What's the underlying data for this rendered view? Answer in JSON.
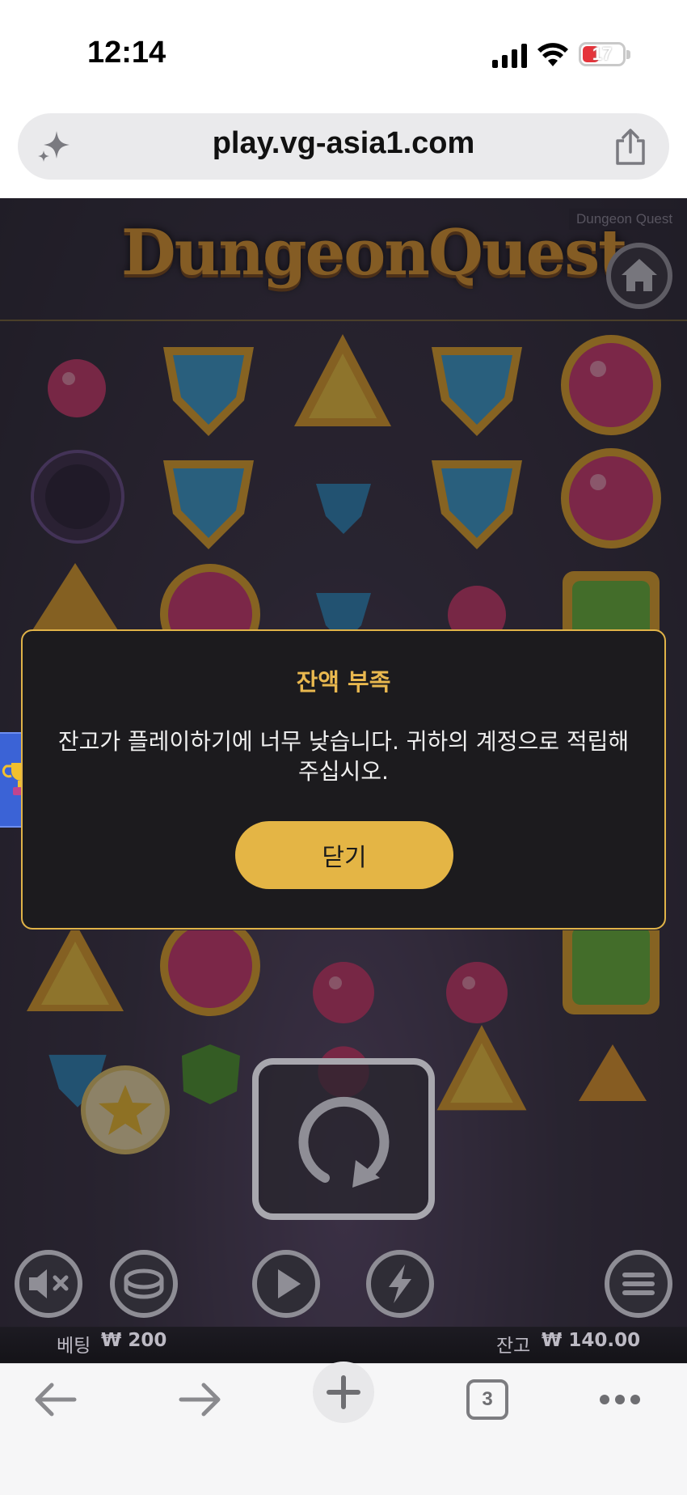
{
  "status_bar": {
    "time": "12:14",
    "battery_level": "17",
    "icons": [
      "signal-icon",
      "wifi-icon",
      "battery-icon"
    ]
  },
  "browser": {
    "url": "play.vg-asia1.com",
    "tab_count": "3",
    "icons": [
      "sparkle-icon",
      "share-icon",
      "back-arrow-icon",
      "forward-arrow-icon",
      "new-tab-plus-icon",
      "tabs-icon",
      "more-dots-icon"
    ]
  },
  "game": {
    "logo_text": "DungeonQuest",
    "title_tag": "Dungeon Quest",
    "bet_label": "베팅",
    "bet_value": "₩ 200",
    "balance_label": "잔고",
    "balance_value": "₩ 140.00",
    "icons": [
      "home-icon",
      "mute-icon",
      "coin-icon",
      "play-icon",
      "lightning-icon",
      "menu-icon",
      "spin-icon",
      "trophy-icon",
      "star-icon"
    ]
  },
  "dialog": {
    "title": "잔액 부족",
    "message": "잔고가 플레이하기에 너무 낮습니다. 귀하의 계정으로 적립해 주십시오.",
    "close_button": "닫기"
  },
  "colors": {
    "dialog_accent": "#e4b545",
    "dialog_bg": "#1c1b1e",
    "game_bg": "#2b2733"
  }
}
